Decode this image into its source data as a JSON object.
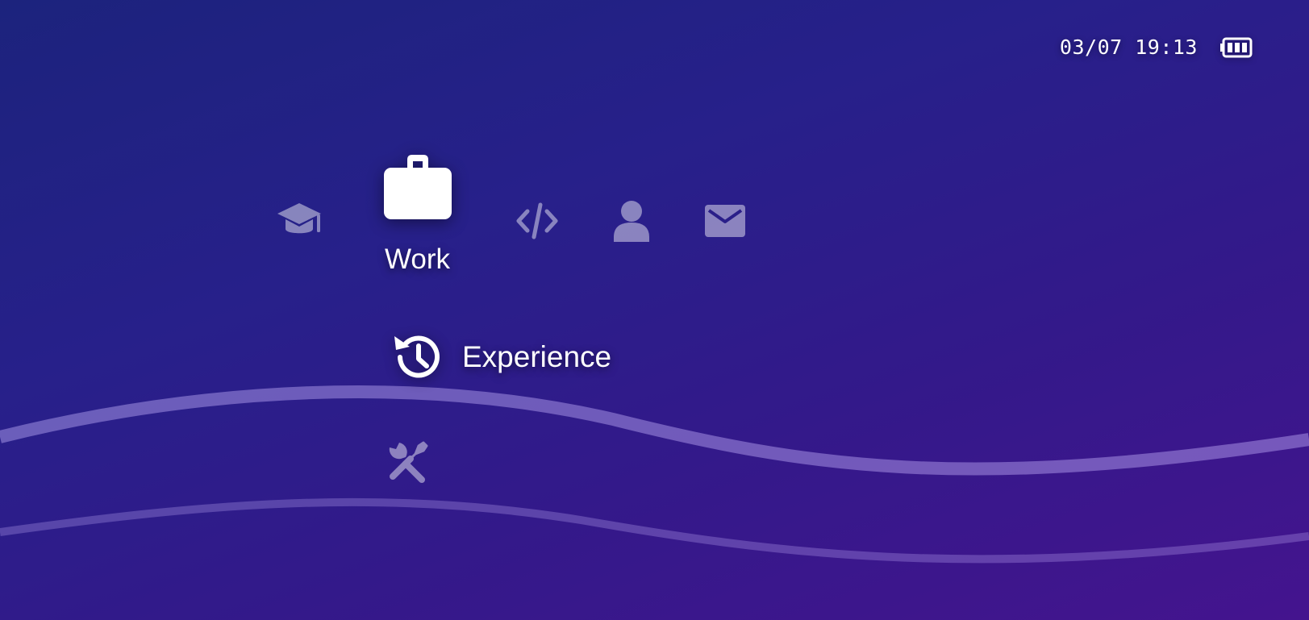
{
  "status": {
    "datetime": "03/07 19:13",
    "battery_icon": "battery-full-icon"
  },
  "categories": [
    {
      "name": "Education",
      "icon": "graduation-cap-icon",
      "selected": false,
      "label": ""
    },
    {
      "name": "Work",
      "icon": "briefcase-icon",
      "selected": true,
      "label": "Work"
    },
    {
      "name": "Code",
      "icon": "code-icon",
      "selected": false,
      "label": ""
    },
    {
      "name": "Profile",
      "icon": "user-icon",
      "selected": false,
      "label": ""
    },
    {
      "name": "Contact",
      "icon": "envelope-icon",
      "selected": false,
      "label": ""
    }
  ],
  "items": [
    {
      "label": "Experience",
      "icon": "history-icon",
      "selected": true
    },
    {
      "label": "",
      "icon": "tools-icon",
      "selected": false
    }
  ],
  "colors": {
    "background_start": "#1c237d",
    "background_end": "#44148e",
    "foreground": "#ffffff"
  }
}
